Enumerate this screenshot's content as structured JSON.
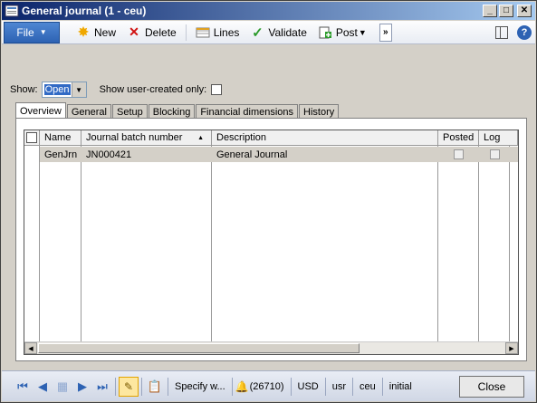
{
  "window": {
    "title": "General journal (1 - ceu)"
  },
  "action_pane": {
    "file_label": "File",
    "buttons": [
      {
        "label": "New",
        "icon": "new-icon"
      },
      {
        "label": "Delete",
        "icon": "delete-icon"
      },
      {
        "label": "Lines",
        "icon": "lines-icon"
      },
      {
        "label": "Validate",
        "icon": "validate-icon"
      },
      {
        "label": "Post",
        "icon": "post-icon"
      }
    ],
    "more_label": "»"
  },
  "filter": {
    "show_label": "Show:",
    "show_value": "Open",
    "user_created_label": "Show user-created only:"
  },
  "tabs": [
    "Overview",
    "General",
    "Setup",
    "Blocking",
    "Financial dimensions",
    "History"
  ],
  "grid": {
    "headers": {
      "name": "Name",
      "batch": "Journal batch number",
      "description": "Description",
      "posted": "Posted",
      "log": "Log"
    },
    "rows": [
      {
        "name": "GenJrn",
        "batch": "JN000421",
        "description": "General Journal"
      }
    ]
  },
  "status_bar": {
    "specify": "Specify w...",
    "alerts": "(26710)",
    "currency": "USD",
    "user": "usr",
    "company": "ceu",
    "initial": "initial",
    "close_label": "Close"
  },
  "colors": {
    "title_bar": "#0a246a",
    "file_button": "#2d62b3",
    "selected_row": "#d4d0c8"
  }
}
